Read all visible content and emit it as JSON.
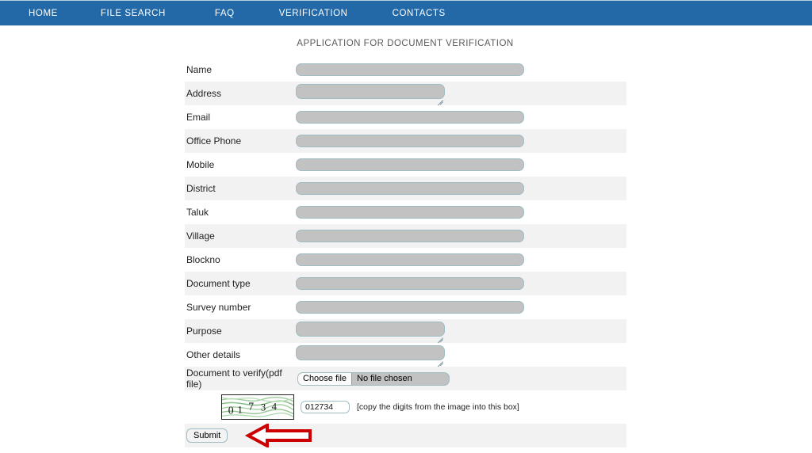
{
  "nav": {
    "items": [
      {
        "label": "HOME"
      },
      {
        "label": "FILE SEARCH"
      },
      {
        "label": "FAQ"
      },
      {
        "label": "VERIFICATION"
      },
      {
        "label": "CONTACTS"
      }
    ],
    "background_color": "#2369a8",
    "text_color": "#ffffff"
  },
  "page": {
    "title": "APPLICATION FOR DOCUMENT VERIFICATION"
  },
  "form": {
    "fields": [
      {
        "label": "Name",
        "type": "text",
        "value": "",
        "placeholder": ""
      },
      {
        "label": "Address",
        "type": "textarea",
        "value": "",
        "placeholder": ""
      },
      {
        "label": "Email",
        "type": "text",
        "value": "",
        "placeholder": ""
      },
      {
        "label": "Office Phone",
        "type": "text",
        "value": "",
        "placeholder": ""
      },
      {
        "label": "Mobile",
        "type": "text",
        "value": "",
        "placeholder": ""
      },
      {
        "label": "District",
        "type": "text",
        "value": "",
        "placeholder": ""
      },
      {
        "label": "Taluk",
        "type": "text",
        "value": "",
        "placeholder": ""
      },
      {
        "label": "Village",
        "type": "text",
        "value": "",
        "placeholder": ""
      },
      {
        "label": "Blockno",
        "type": "text",
        "value": "",
        "placeholder": ""
      },
      {
        "label": "Document type",
        "type": "text",
        "value": "",
        "placeholder": ""
      },
      {
        "label": "Survey number",
        "type": "text",
        "value": "",
        "placeholder": ""
      },
      {
        "label": "Purpose",
        "type": "textarea",
        "value": "",
        "placeholder": ""
      },
      {
        "label": "Other details",
        "type": "textarea",
        "value": "",
        "placeholder": ""
      }
    ],
    "file_field": {
      "label": "Document to verify(pdf file)",
      "button_label": "Choose file",
      "file_status": "No file chosen"
    },
    "captcha": {
      "image_digits": "01734",
      "input_value": "012734",
      "hint": "[copy the digits from the image into this box]",
      "line_color": "#8fbf8f"
    },
    "submit": {
      "label": "Submit"
    },
    "arrow": {
      "color": "#cc0000",
      "fill": "#ffffff",
      "direction": "left"
    },
    "row_colors": {
      "odd": "#ffffff",
      "even": "#f2f2f2"
    },
    "input_colors": {
      "fill": "#c2c2c2",
      "border": "#9fbcc4"
    }
  }
}
